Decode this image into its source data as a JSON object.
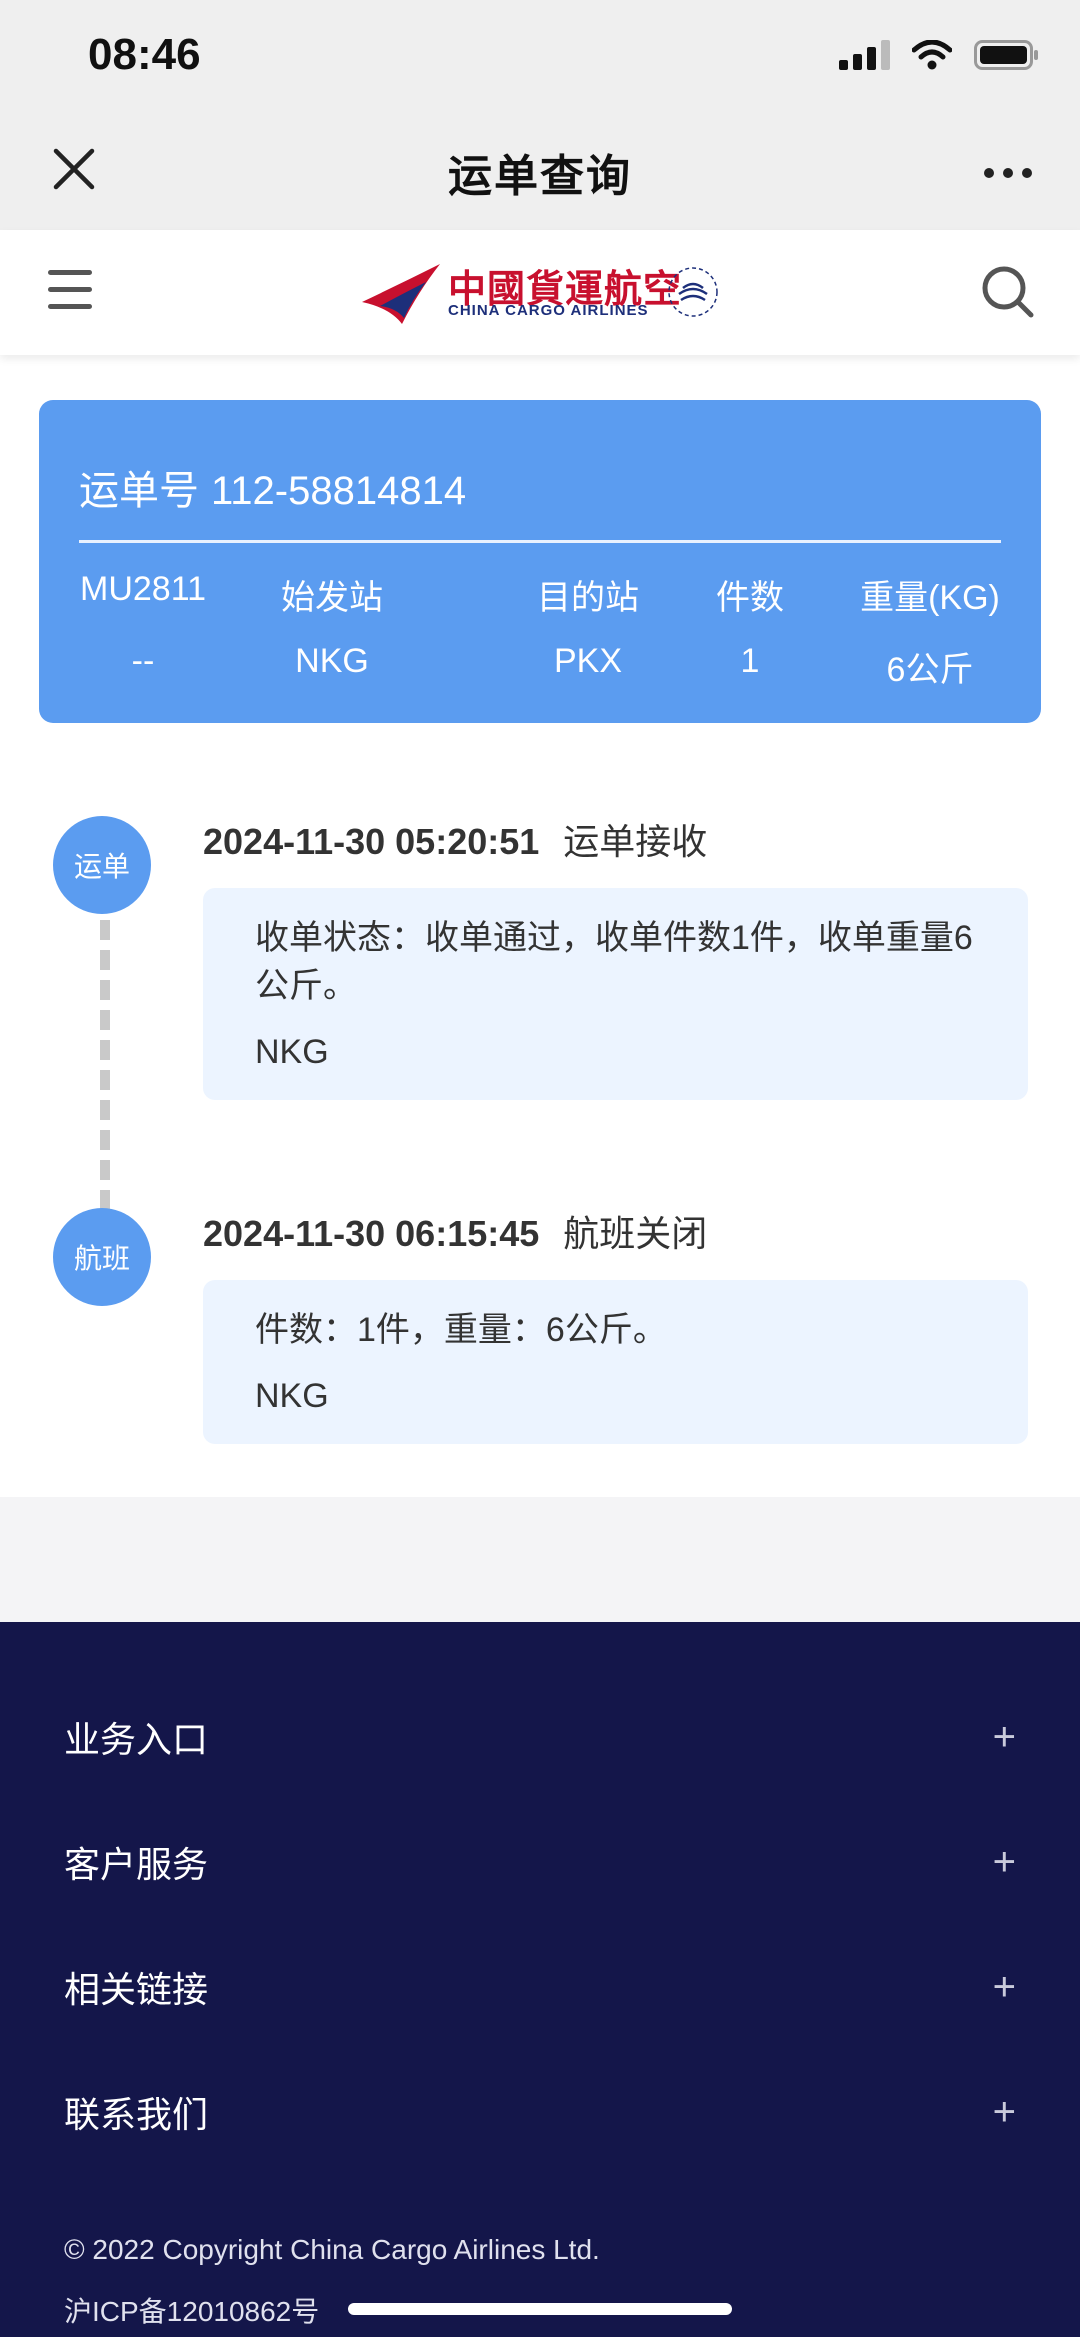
{
  "status_bar": {
    "time": "08:46"
  },
  "nav": {
    "title": "运单查询"
  },
  "site_header": {
    "logo_cn": "中國貨運航空",
    "logo_en": "CHINA CARGO AIRLINES"
  },
  "waybill": {
    "label": "运单号",
    "number": "112-58814814",
    "headers": [
      "MU2811",
      "始发站",
      "目的站",
      "件数",
      "重量(KG)"
    ],
    "values": [
      "--",
      "NKG",
      "PKX",
      "1",
      "6公斤"
    ]
  },
  "timeline": [
    {
      "badge": "运单",
      "timestamp": "2024-11-30 05:20:51",
      "event": "运单接收",
      "detail": "收单状态：收单通过，收单件数1件，收单重量6公斤。",
      "location": "NKG"
    },
    {
      "badge": "航班",
      "timestamp": "2024-11-30 06:15:45",
      "event": "航班关闭",
      "detail": "件数：1件，重量：6公斤。",
      "location": "NKG"
    }
  ],
  "footer": {
    "items": [
      "业务入口",
      "客户服务",
      "相关链接",
      "联系我们"
    ],
    "expand_symbol": "+",
    "copyright": "© 2022 Copyright China Cargo Airlines Ltd.",
    "icp": "沪ICP备12010862号"
  },
  "colors": {
    "accent": "#5b9cf0",
    "footer_bg": "#14164a",
    "brand_red": "#c8102e"
  }
}
